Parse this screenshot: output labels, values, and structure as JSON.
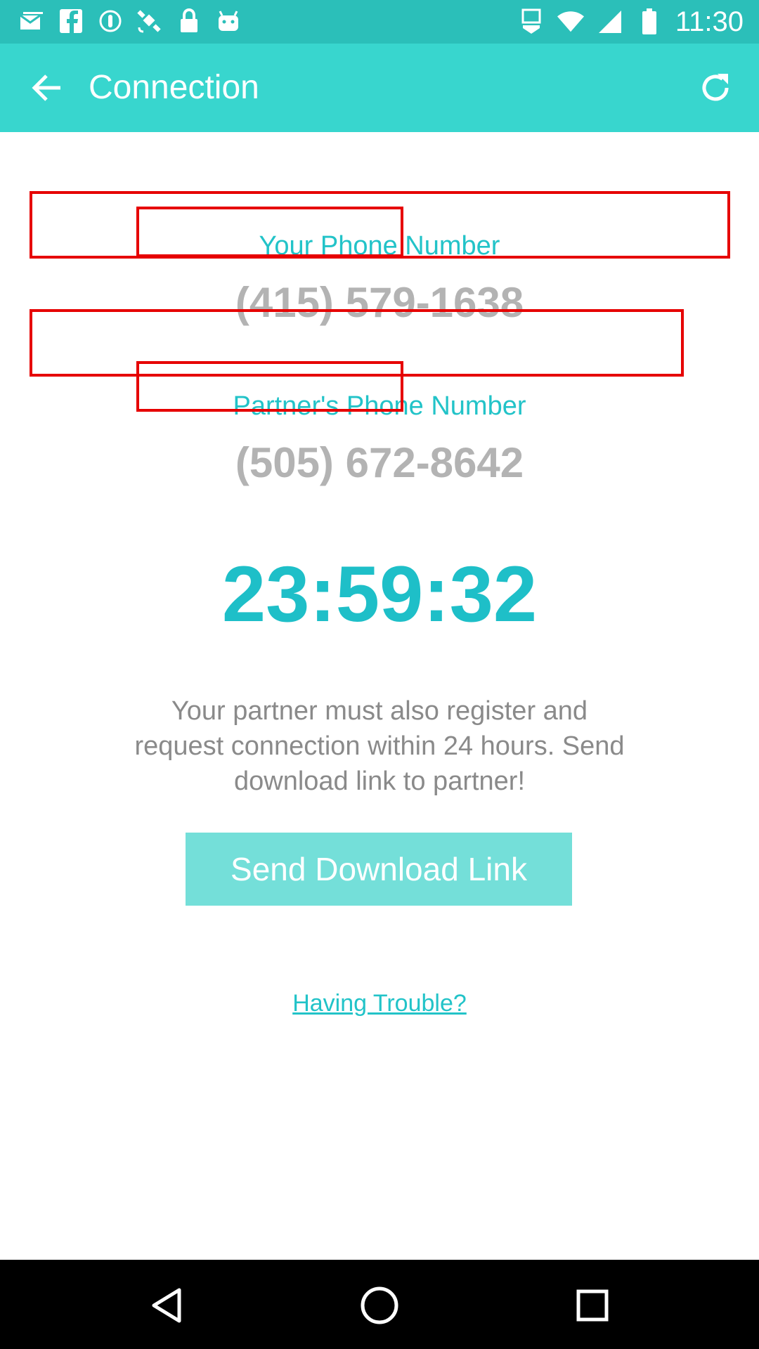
{
  "status_bar": {
    "time": "11:30",
    "left_icons": [
      "mail-icon",
      "facebook-icon",
      "sync-icon",
      "satellite-icon",
      "lock-icon",
      "android-icon"
    ],
    "right_icons": [
      "cast-icon",
      "wifi-icon",
      "signal-icon",
      "battery-icon"
    ]
  },
  "app_bar": {
    "title": "Connection",
    "background": "#38d6ce"
  },
  "connection": {
    "your_label": "Your Phone Number",
    "your_number": "(415) 579-1638",
    "partner_label": "Partner's Phone Number",
    "partner_number": "(505) 672-8642",
    "countdown": "23:59:32",
    "info_line1": "Your partner must also register and",
    "info_line2": "request connection within 24 hours. Send",
    "info_line3": "download link to partner!",
    "send_button": "Send Download Link",
    "trouble_link": "Having Trouble?"
  },
  "colors": {
    "accent": "#22c3c8",
    "button": "#74dfd9",
    "phone_text": "#b3b3b3",
    "highlight_box": "#e60000"
  },
  "nav_bar": {
    "buttons": [
      "back-triangle-icon",
      "home-circle-icon",
      "recents-square-icon"
    ]
  }
}
